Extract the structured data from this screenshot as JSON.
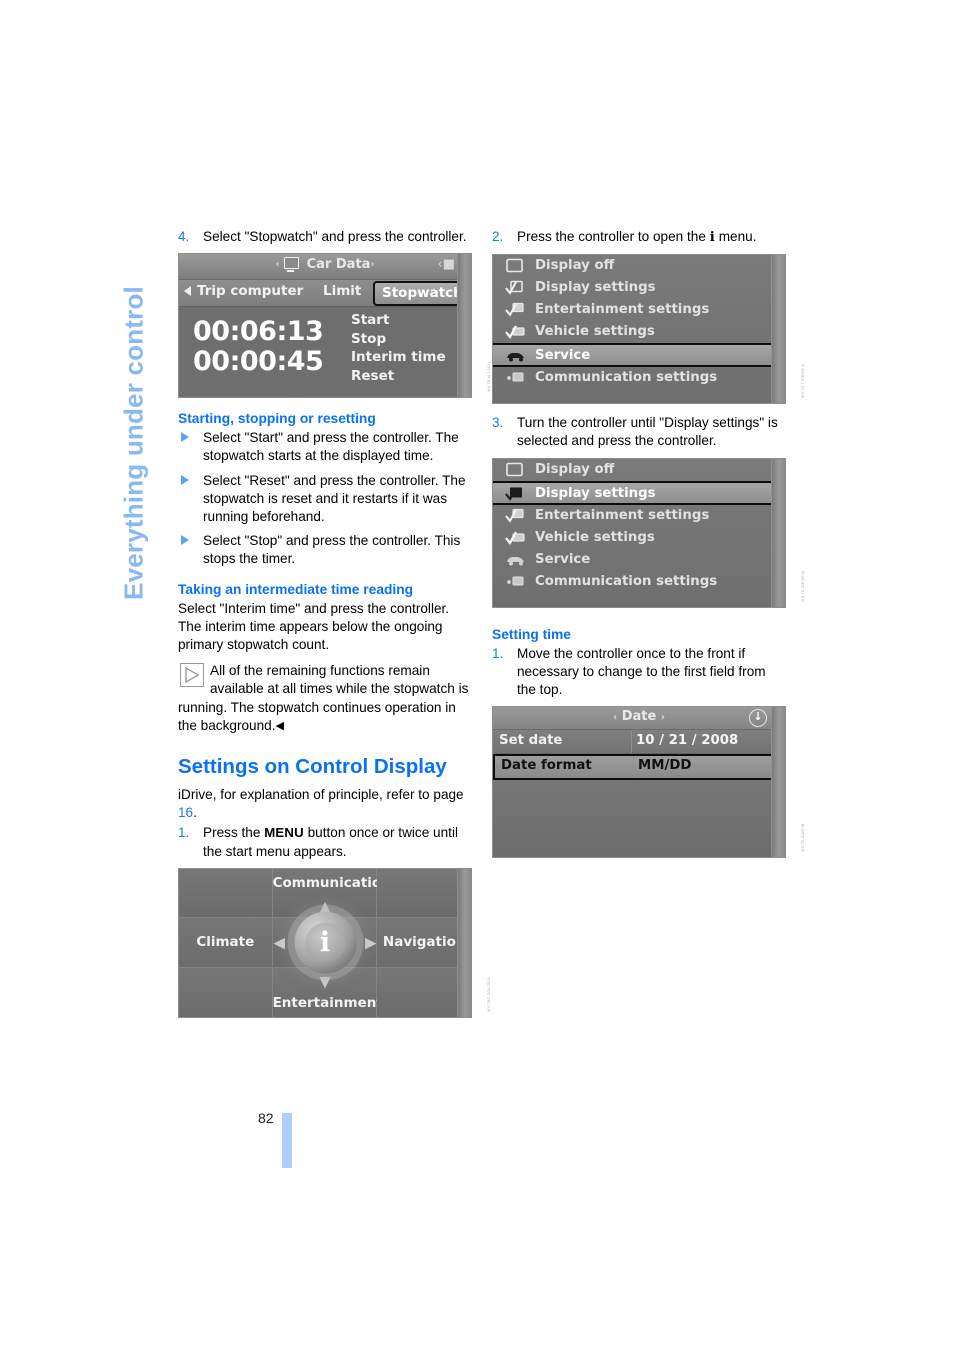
{
  "chapter_tab": {
    "label": "Everything under control"
  },
  "page": {
    "number": "82"
  },
  "left_column": {
    "step4": {
      "num": "4.",
      "text": "Select \"Stopwatch\" and press the controller."
    },
    "car_data_screen": {
      "title": "Car Data",
      "title_left_arrow": "‹",
      "title_right_arrow": "›",
      "monitor_icon": "monitor-icon",
      "tabs": [
        "Trip computer",
        "Limit",
        "Stopwatch"
      ],
      "selected_tab": "Stopwatch",
      "primary_time": "00:06:13",
      "interim_time": "00:00:45",
      "actions": [
        "Start",
        "Stop",
        "Interim time",
        "Reset"
      ],
      "credit": "WS.TR.ALT.0101"
    },
    "section_start_stop": {
      "heading": "Starting, stopping or resetting",
      "bullets": [
        "Select \"Start\" and press the controller. The stopwatch starts at the displayed time.",
        "Select \"Reset\" and press the controller. The stopwatch is reset and it restarts if it was running beforehand.",
        "Select \"Stop\" and press the controller. This stops the timer."
      ]
    },
    "section_interim": {
      "heading": "Taking an intermediate time reading",
      "paragraph": "Select \"Interim time\" and press the controller. The interim time appears below the ongoing primary stopwatch count.",
      "note_icon": "note-triangle-icon",
      "note": "All of the remaining functions remain available at all times while the stopwatch is running. The stopwatch continues operation in the background.",
      "note_end_marker": "◀"
    },
    "section_settings": {
      "heading": "Settings on Control Display",
      "intro_before": "iDrive, for explanation of principle, refer to page ",
      "intro_page_link": "16",
      "intro_after": ".",
      "step1_num": "1.",
      "step1_before": "Press the ",
      "step1_keyword": "MENU",
      "step1_after": " button once or twice until the start menu appears."
    },
    "start_menu_screen": {
      "cells": {
        "communication": "Communication",
        "climate": "Climate",
        "navigation": "Navigation",
        "entertainment": "Entertainment"
      },
      "center_icon": "i",
      "arrows": {
        "up": "▲",
        "down": "▼",
        "left": "◀",
        "right": "▶"
      },
      "credit": "WS.TRC.CONTR4A"
    }
  },
  "right_column": {
    "step2": {
      "num": "2.",
      "text_before": "Press the controller to open the ",
      "icon": "i",
      "text_after": " menu."
    },
    "imenu_screen_1": {
      "rows": [
        {
          "label": "Display off",
          "icon": "display-off-icon",
          "selected": false
        },
        {
          "label": "Display settings",
          "icon": "display-settings-icon",
          "selected": false
        },
        {
          "label": "Entertainment settings",
          "icon": "entertainment-settings-icon",
          "selected": false
        },
        {
          "label": "Vehicle settings",
          "icon": "vehicle-settings-icon",
          "selected": false
        },
        {
          "label": "Service",
          "icon": "car-service-icon",
          "selected": true
        },
        {
          "label": "Communication settings",
          "icon": "communication-icon",
          "selected": false
        }
      ],
      "credit": "WS.TD.T.IDRIVE.A"
    },
    "step3": {
      "num": "3.",
      "text": "Turn the controller until \"Display settings\" is selected and press the controller."
    },
    "imenu_screen_2": {
      "rows": [
        {
          "label": "Display off",
          "icon": "display-off-icon",
          "selected": false
        },
        {
          "label": "Display settings",
          "icon": "display-settings-icon",
          "selected": true
        },
        {
          "label": "Entertainment settings",
          "icon": "entertainment-settings-icon",
          "selected": false
        },
        {
          "label": "Vehicle settings",
          "icon": "vehicle-settings-icon",
          "selected": false
        },
        {
          "label": "Service",
          "icon": "car-service-icon",
          "selected": false
        },
        {
          "label": "Communication settings",
          "icon": "communication-icon",
          "selected": false
        }
      ],
      "credit": "WS.TD.IDRIVE.M"
    },
    "section_setting_time": {
      "heading": "Setting time",
      "step1_num": "1.",
      "step1_text": "Move the controller once to the front if necessary to change to the first field from the top."
    },
    "date_screen": {
      "title": "Date",
      "title_left_arrow": "‹",
      "title_right_arrow": "›",
      "badge_icon": "info-arrow-icon",
      "rows": [
        {
          "label": "Set date",
          "value": "10 / 21 / 2008",
          "selected": false
        },
        {
          "label": "Date format",
          "value": "MM/DD",
          "selected": true
        }
      ],
      "credit": "WS.TD.DATE.M"
    }
  }
}
